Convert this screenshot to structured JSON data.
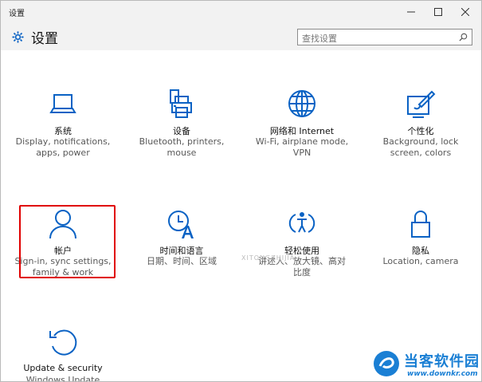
{
  "window": {
    "title": "设置",
    "controls": {
      "minimize": "minimize",
      "maximize": "maximize",
      "close": "close"
    }
  },
  "header": {
    "title": "设置",
    "search_placeholder": "查找设置"
  },
  "tiles": [
    {
      "name": "系统",
      "desc": [
        "Display, notifications,",
        "apps, power"
      ],
      "icon": "laptop-icon"
    },
    {
      "name": "设备",
      "desc": [
        "Bluetooth, printers,",
        "mouse"
      ],
      "icon": "printer-icon"
    },
    {
      "name": "网络和 Internet",
      "desc": [
        "Wi-Fi, airplane mode,",
        "VPN"
      ],
      "icon": "globe-icon"
    },
    {
      "name": "个性化",
      "desc": [
        "Background, lock",
        "screen, colors"
      ],
      "icon": "paint-icon"
    },
    {
      "name": "帐户",
      "desc": [
        "Sign-in, sync settings,",
        "family & work"
      ],
      "icon": "person-icon"
    },
    {
      "name": "时间和语言",
      "desc": [
        "日期、时间、区域"
      ],
      "icon": "clock-language-icon"
    },
    {
      "name": "轻松使用",
      "desc": [
        "讲述人、放大镜、高对",
        "比度"
      ],
      "icon": "ease-of-access-icon"
    },
    {
      "name": "隐私",
      "desc": [
        "Location, camera"
      ],
      "icon": "lock-icon"
    },
    {
      "name": "Update & security",
      "desc": [
        "Windows Update"
      ],
      "icon": "refresh-icon"
    }
  ],
  "watermark": "XITONGZHIJIA",
  "brand": {
    "name": "当客软件园",
    "url": "www.downkr.com"
  },
  "colors": {
    "accent": "#0a62c4",
    "highlight": "#e00000",
    "brand": "#1a7fd4"
  }
}
